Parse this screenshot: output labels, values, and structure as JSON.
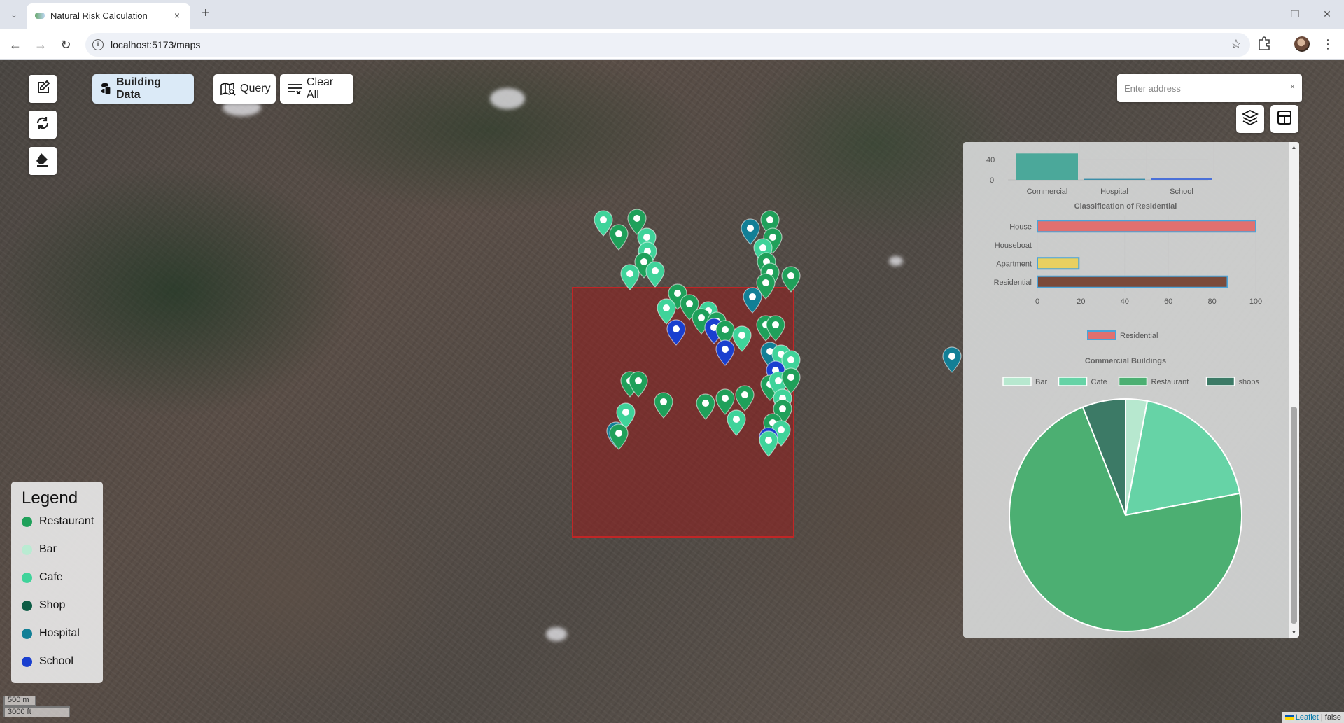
{
  "browser": {
    "tab_title": "Natural Risk Calculation",
    "url": "localhost:5173/maps",
    "new_tab": "+",
    "close_tab": "×",
    "minimize": "—",
    "restore": "❐",
    "close_window": "✕"
  },
  "map_tools": {
    "draw": "edit-icon",
    "refresh": "refresh-icon",
    "erase": "eraser-icon"
  },
  "top_buttons": {
    "building_data": "Building Data",
    "query": "Query",
    "clear_all": "Clear All"
  },
  "address": {
    "placeholder": "Enter address",
    "clear": "×"
  },
  "legend": {
    "title": "Legend",
    "items": [
      {
        "label": "Restaurant",
        "color": "#1fa05a"
      },
      {
        "label": "Bar",
        "color": "#b9ebd2"
      },
      {
        "label": "Cafe",
        "color": "#3fd39a"
      },
      {
        "label": "Shop",
        "color": "#0d5c45"
      },
      {
        "label": "Hospital",
        "color": "#127f96"
      },
      {
        "label": "School",
        "color": "#1a3fcf"
      }
    ]
  },
  "scale": {
    "metric": "500 m",
    "imperial": "3000 ft"
  },
  "attribution": {
    "leaflet": "Leaflet",
    "rest": "| false"
  },
  "chart_data": [
    {
      "type": "bar",
      "title": "",
      "categories": [
        "Commercial",
        "Hospital",
        "School"
      ],
      "values": [
        52,
        2,
        4
      ],
      "y_ticks": [
        "40",
        "0"
      ],
      "colors": [
        "#4ba89a",
        "#3c8ea8",
        "#4a70d8"
      ]
    },
    {
      "type": "bar",
      "orientation": "horizontal",
      "title": "Classification of Residential",
      "categories": [
        "House",
        "Houseboat",
        "Apartment",
        "Residential"
      ],
      "values": [
        100,
        0,
        19,
        87
      ],
      "xlim": [
        0,
        100
      ],
      "x_ticks": [
        "0",
        "20",
        "40",
        "60",
        "80",
        "100"
      ],
      "colors": [
        "#e07070",
        "#e07070",
        "#e8d060",
        "#7a4a3a"
      ],
      "border_color": "#4aa3d8",
      "legend": [
        "Residential"
      ]
    },
    {
      "type": "pie",
      "title": "Commercial Buildings",
      "categories": [
        "Bar",
        "Cafe",
        "Restaurant",
        "shops"
      ],
      "values": [
        3,
        19,
        72,
        6
      ],
      "colors": [
        "#b7e8cf",
        "#66d3a6",
        "#4caf72",
        "#3c7a66"
      ]
    }
  ]
}
